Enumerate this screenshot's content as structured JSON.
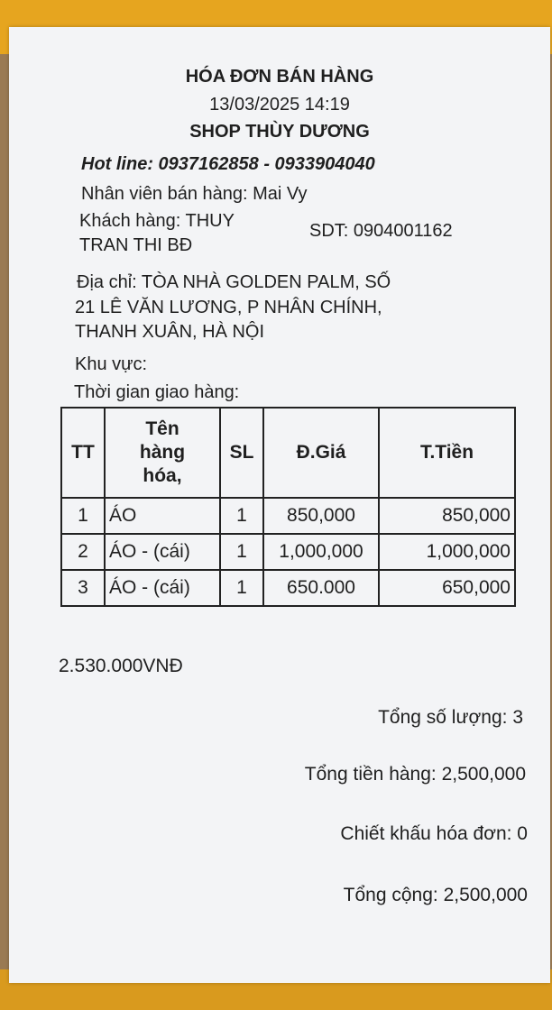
{
  "invoice": {
    "title": "HÓA ĐƠN BÁN HÀNG",
    "datetime": "13/03/2025 14:19",
    "shop": "SHOP THÙY DƯƠNG",
    "hotline": "Hot line: 0937162858 - 0933904040",
    "staff": "Nhân viên bán hàng: Mai Vy",
    "customer_line1": "Khách hàng: THUY",
    "customer_line2": "TRAN THI BĐ",
    "phone": "SDT: 0904001162",
    "address_line1": "Địa chỉ: TÒA NHÀ GOLDEN PALM, SỐ",
    "address_line2": "21 LÊ VĂN LƯƠNG, P NHÂN CHÍNH,",
    "address_line3": "THANH XUÂN, HÀ NỘI",
    "area": "Khu vực:",
    "delivery_time": "Thời gian giao hàng:"
  },
  "table": {
    "headers": [
      "TT",
      "Tên hàng hóa,",
      "SL",
      "Đ.Giá",
      "T.Tiền"
    ],
    "header_name_lines": [
      "Tên",
      "hàng",
      "hóa,"
    ],
    "rows": [
      [
        "1",
        "ÁO",
        "1",
        "850,000",
        "850,000"
      ],
      [
        "2",
        "ÁO - (cái)",
        "1",
        "1,000,000",
        "1,000,000"
      ],
      [
        "3",
        "ÁO - (cái)",
        "1",
        "650.000",
        "650,000"
      ]
    ]
  },
  "handwritten_total": "2.530.000VNĐ",
  "summary": {
    "total_quantity": "Tổng số lượng: 3",
    "total_goods": "Tổng tiền hàng: 2,500,000",
    "discount": "Chiết khấu hóa đơn: 0",
    "grand_total": "Tổng cộng: 2,500,000"
  },
  "colors": {
    "paper": "#f3f4f6",
    "tape": "#e6a51f",
    "cardboard": "#a07f57",
    "ink": "#1f1f1f"
  }
}
